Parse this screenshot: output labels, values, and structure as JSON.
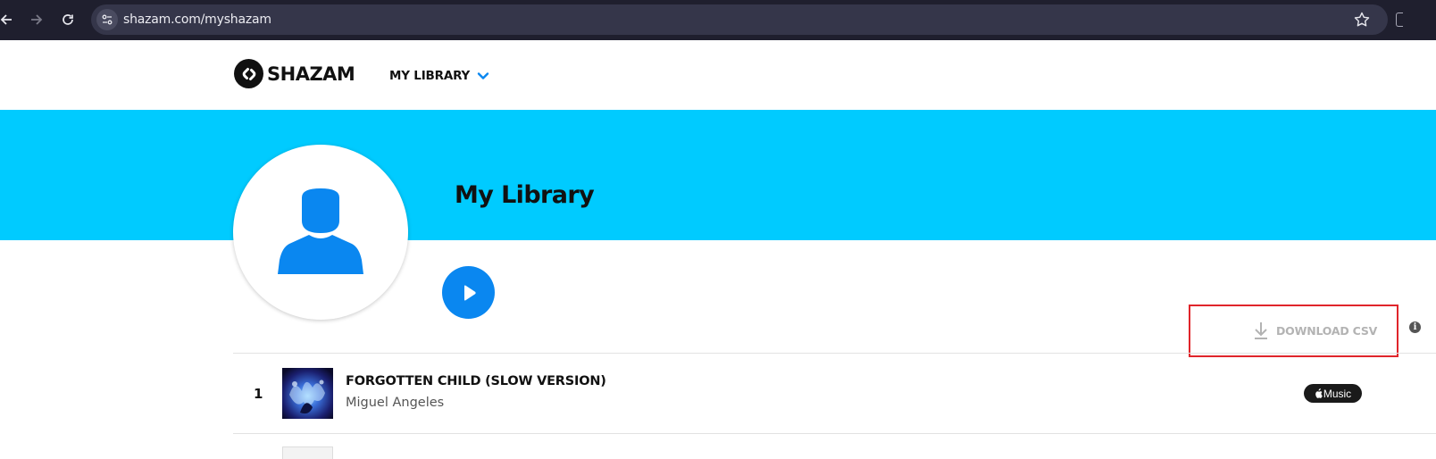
{
  "browser": {
    "url": "shazam.com/myshazam",
    "icons": [
      "back-arrow-icon",
      "forward-arrow-icon",
      "reload-icon",
      "site-info-icon",
      "star-icon"
    ]
  },
  "header": {
    "logo_text": "SHAZAM",
    "menu_label": "MY LIBRARY"
  },
  "hero": {
    "title": "My Library",
    "accent_color": "#00cbff",
    "button_color": "#0a87f0"
  },
  "actions": {
    "download_label": "DOWNLOAD CSV",
    "info_glyph": "i"
  },
  "tracks": [
    {
      "index": "1",
      "title": "FORGOTTEN CHILD (SLOW VERSION)",
      "artist": "Miguel Angeles",
      "service_label": "Music"
    }
  ]
}
